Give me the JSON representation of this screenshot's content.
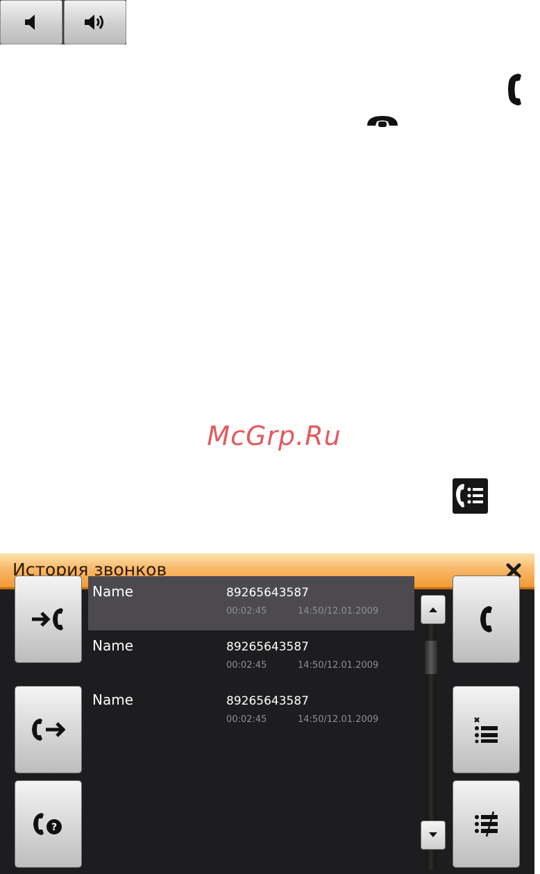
{
  "toolbar": {
    "volume_down_icon": "volume-down-icon",
    "volume_up_icon": "volume-up-icon"
  },
  "legend_icons": {
    "call": "phone-icon",
    "hangup": "hang-up-icon",
    "history": "call-history-icon"
  },
  "watermark": "McGrp.Ru",
  "dialog": {
    "title": "История звонков",
    "close_icon": "close-icon",
    "accent_color": "#f29a34",
    "left_buttons": [
      "incoming-calls-icon",
      "outgoing-calls-icon",
      "missed-calls-icon"
    ],
    "right_buttons": [
      "call-icon",
      "delete-entry-icon",
      "delete-all-icon"
    ],
    "calls": [
      {
        "name": "Name",
        "number": "89265643587",
        "duration": "00:02:45",
        "datetime": "14:50/12.01.2009",
        "selected": true
      },
      {
        "name": "Name",
        "number": "89265643587",
        "duration": "00:02:45",
        "datetime": "14:50/12.01.2009",
        "selected": false
      },
      {
        "name": "Name",
        "number": "89265643587",
        "duration": "00:02:45",
        "datetime": "14:50/12.01.2009",
        "selected": false
      }
    ]
  }
}
